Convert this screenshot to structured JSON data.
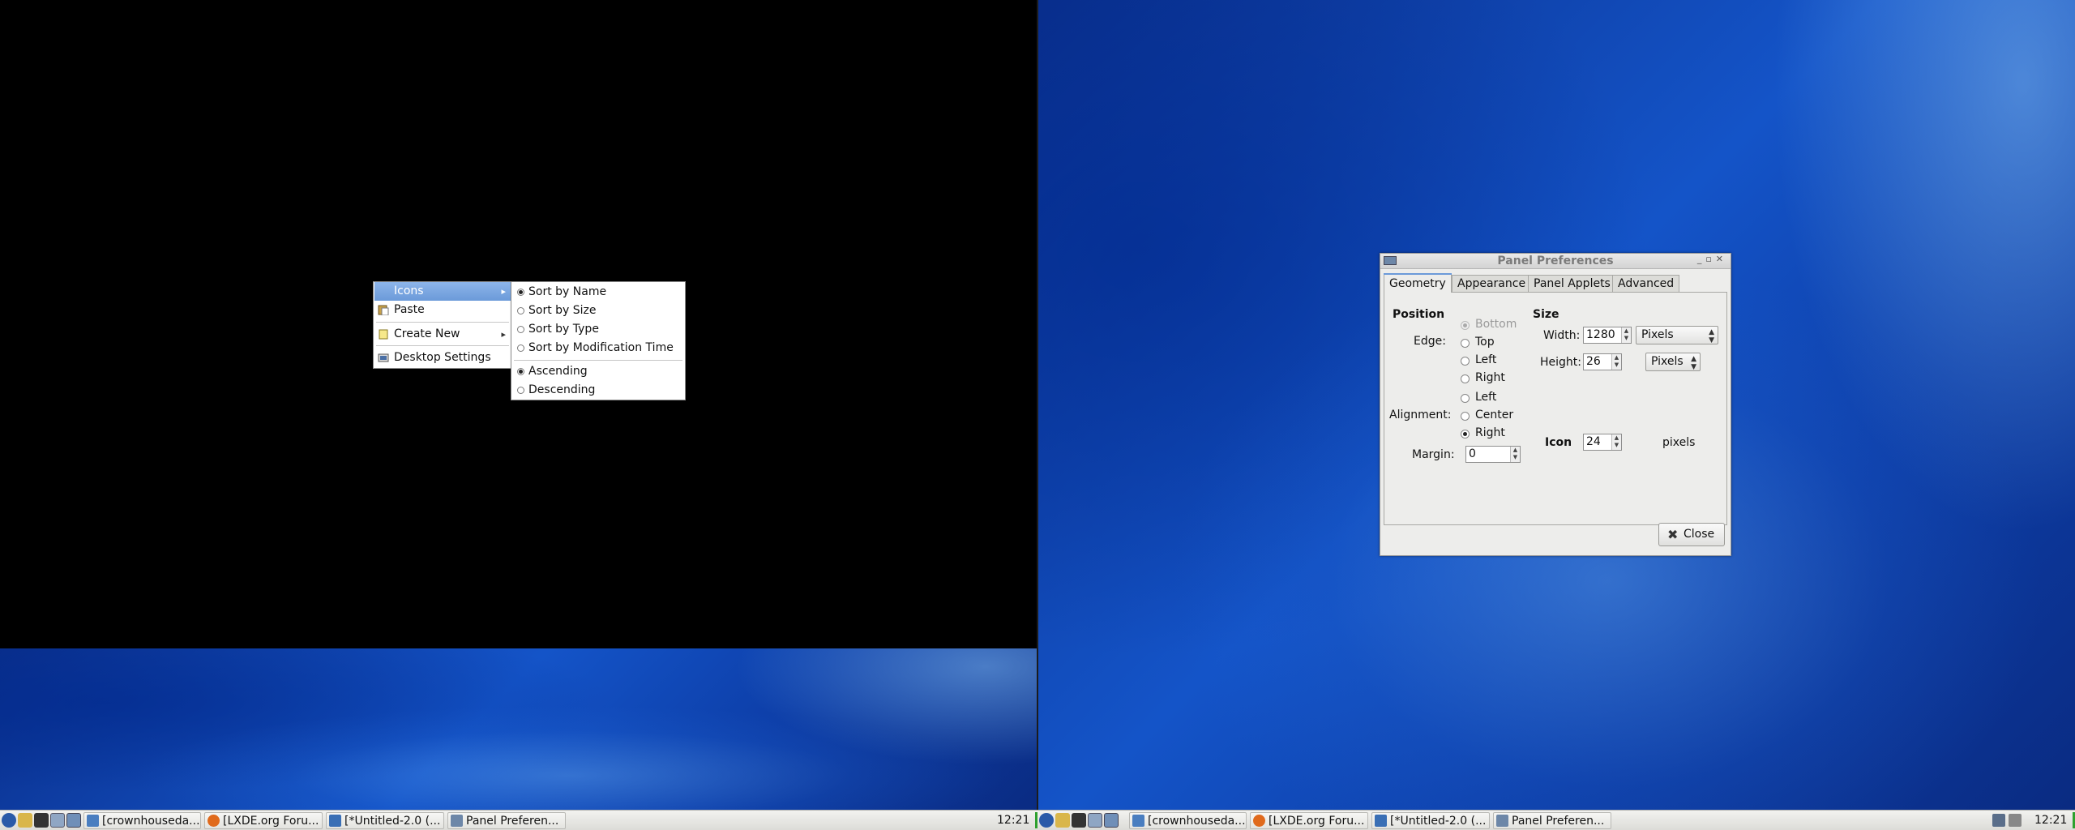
{
  "context_menu": {
    "items": [
      {
        "label": "Icons",
        "has_submenu": true,
        "selected": true
      },
      {
        "label": "Paste",
        "icon": "paste-icon"
      },
      {
        "label": "Create New",
        "icon": "new-file-icon",
        "has_submenu": true
      },
      {
        "label": "Desktop Settings",
        "icon": "settings-icon"
      }
    ]
  },
  "icons_submenu": {
    "sort_items": [
      {
        "label": "Sort by Name",
        "checked": true
      },
      {
        "label": "Sort by Size",
        "checked": false
      },
      {
        "label": "Sort by Type",
        "checked": false
      },
      {
        "label": "Sort by Modification Time",
        "checked": false
      }
    ],
    "order_items": [
      {
        "label": "Ascending",
        "checked": true
      },
      {
        "label": "Descending",
        "checked": false
      }
    ]
  },
  "panel_preferences": {
    "title": "Panel Preferences",
    "tabs": [
      "Geometry",
      "Appearance",
      "Panel Applets",
      "Advanced"
    ],
    "active_tab": "Geometry",
    "position_heading": "Position",
    "size_heading": "Size",
    "edge_label": "Edge:",
    "edge_options": [
      "Bottom",
      "Top",
      "Left",
      "Right"
    ],
    "edge_selected": "Bottom",
    "alignment_label": "Alignment:",
    "alignment_options": [
      "Left",
      "Center",
      "Right"
    ],
    "alignment_selected": "Right",
    "margin_label": "Margin:",
    "margin_value": "0",
    "width_label": "Width:",
    "width_value": "1280",
    "width_unit": "Pixels",
    "height_label": "Height:",
    "height_value": "26",
    "height_unit": "Pixels",
    "icon_label": "Icon",
    "icon_value": "24",
    "icon_unit": "pixels",
    "close_label": "Close"
  },
  "taskbar_left": {
    "tasks": [
      "[crownhouseda...",
      "[LXDE.org Foru...",
      "[*Untitled-2.0 (...",
      "Panel Preferen..."
    ],
    "clock": "12:21"
  },
  "taskbar_right": {
    "tasks": [
      "[crownhouseda...",
      "[LXDE.org Foru...",
      "[*Untitled-2.0 (...",
      "Panel Preferen..."
    ],
    "clock": "12:21"
  }
}
